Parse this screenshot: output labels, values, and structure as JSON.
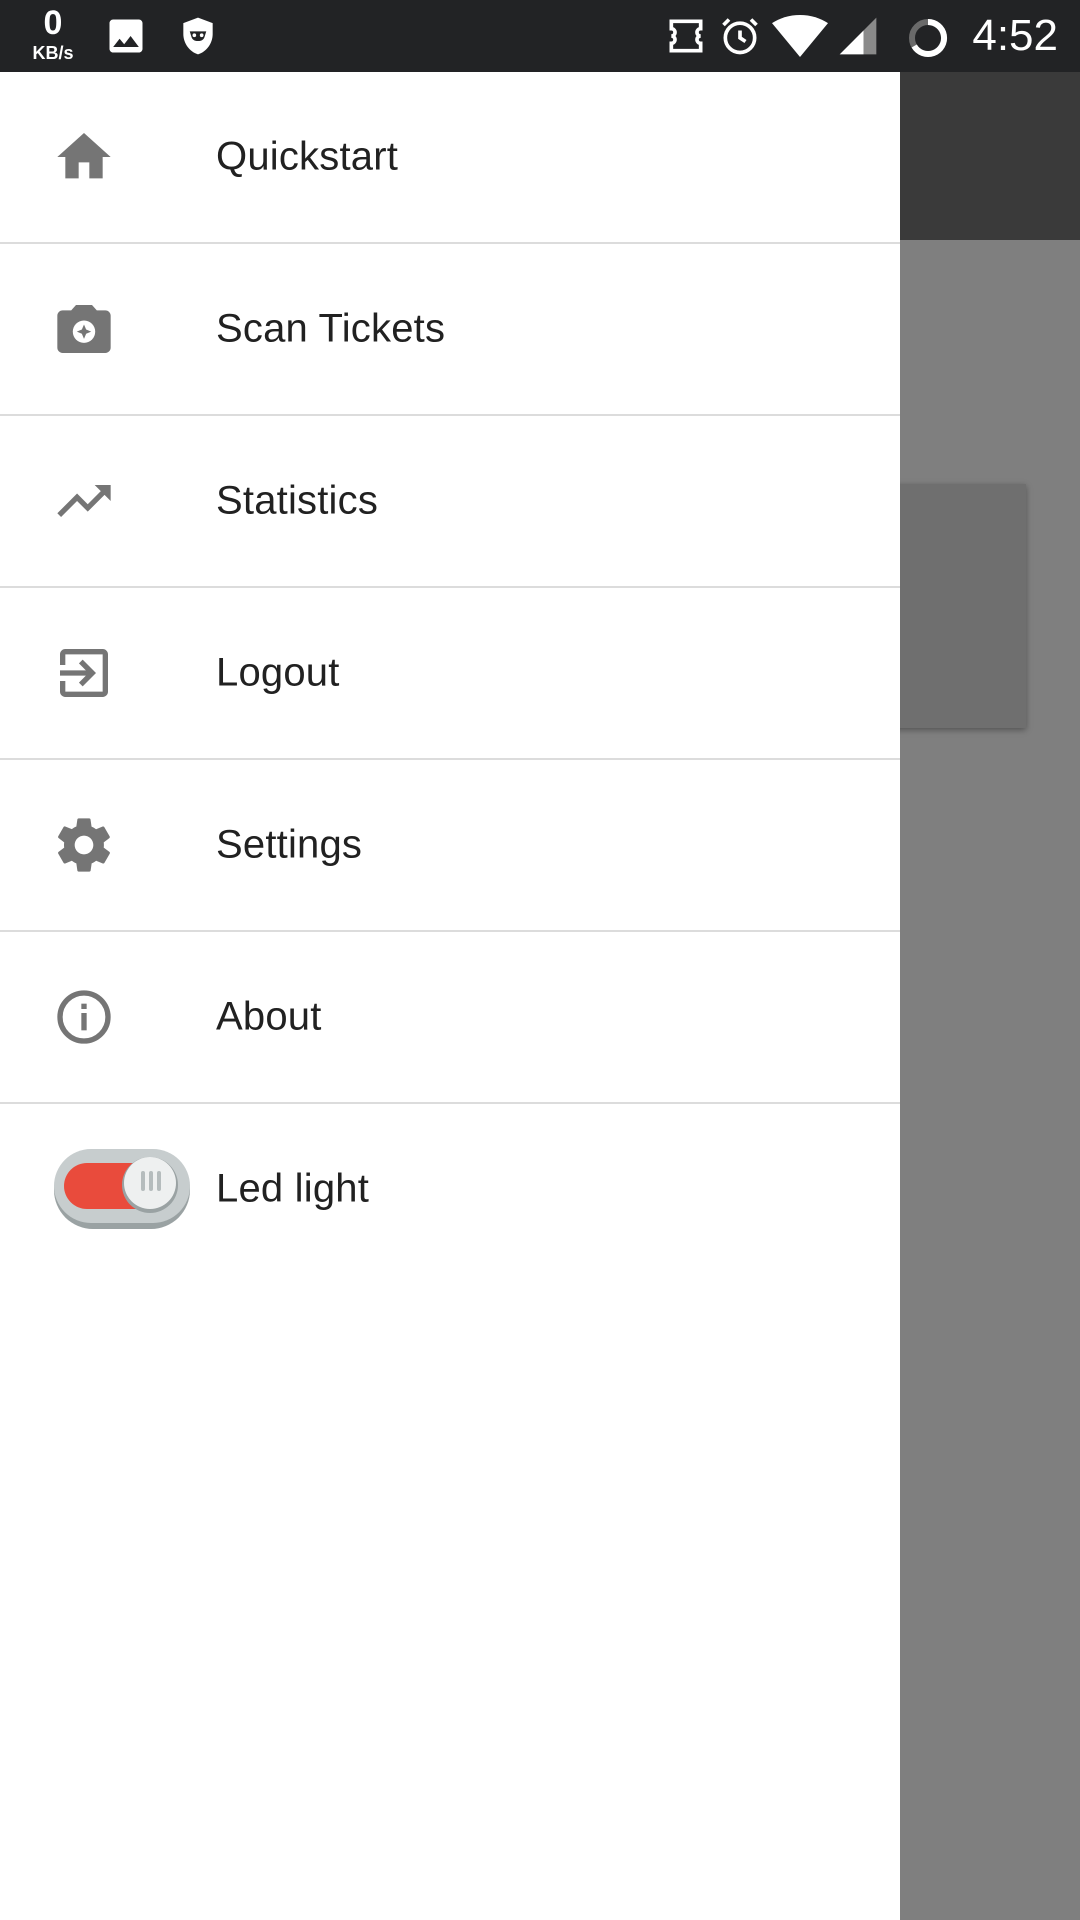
{
  "status_bar": {
    "speed_value": "0",
    "speed_unit": "KB/s",
    "time": "4:52",
    "icons": [
      "image-icon",
      "shield-icon",
      "ticket-icon",
      "alarm-icon",
      "wifi-icon",
      "signal-icon",
      "sync-icon"
    ]
  },
  "drawer": {
    "items": [
      {
        "label": "Quickstart",
        "icon": "home-icon"
      },
      {
        "label": "Scan Tickets",
        "icon": "camera-icon"
      },
      {
        "label": "Statistics",
        "icon": "trending-up-icon"
      },
      {
        "label": "Logout",
        "icon": "exit-icon"
      },
      {
        "label": "Settings",
        "icon": "gear-icon"
      },
      {
        "label": "About",
        "icon": "info-icon"
      }
    ],
    "led": {
      "label": "Led light",
      "enabled": true
    }
  },
  "colors": {
    "drawer_bg": "#ffffff",
    "icon": "#757575",
    "text": "#212121",
    "toggle_on": "#e94b3c",
    "scrim": "#7f7f7f"
  }
}
